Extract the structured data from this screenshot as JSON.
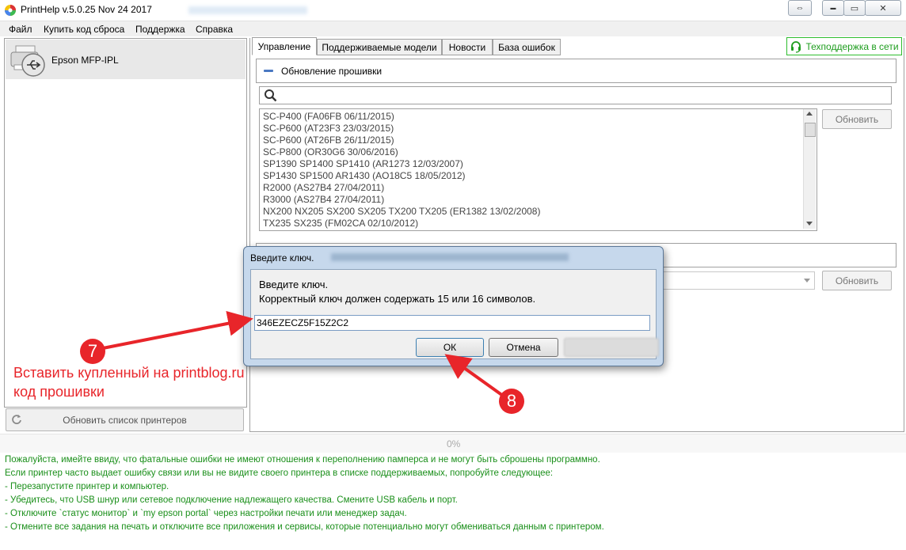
{
  "window": {
    "title": "PrintHelp v.5.0.25 Nov 24 2017",
    "close_glyph": "✕",
    "maximize_glyph": "▭",
    "minimize_glyph": "▬",
    "restore_glyph": "⇔"
  },
  "menu": {
    "items": [
      "Файл",
      "Купить код сброса",
      "Поддержка",
      "Справка"
    ]
  },
  "printers": {
    "items": [
      {
        "label": "Epson MFP-IPL",
        "icon": "usb-printer-icon"
      }
    ],
    "refresh_label": "Обновить список принтеров"
  },
  "tabs": {
    "items": [
      "Управление",
      "Поддерживаемые модели",
      "Новости",
      "База ошибок"
    ],
    "active": 0
  },
  "support_label": "Техподдержка в сети",
  "firmware": {
    "section_title": "Обновление прошивки",
    "list": [
      "SC-P400 (FA06FB 06/11/2015)",
      "SC-P600 (AT23F3 23/03/2015)",
      "SC-P600 (AT26FB 26/11/2015)",
      "SC-P800 (OR30G6 30/06/2016)",
      "SP1390 SP1400 SP1410 (AR1273 12/03/2007)",
      "SP1430 SP1500 AR1430 (AO18C5 18/05/2012)",
      "R2000 (AS27B4 27/04/2011)",
      "R3000 (AS27B4 27/04/2011)",
      "NX200 NX205 SX200 SX205 TX200 TX205 (ER1382 13/02/2008)",
      "TX235 SX235 (FM02CA 02/10/2012)"
    ],
    "update_label": "Обновить"
  },
  "section2": {
    "update_label": "Обновить"
  },
  "progress": {
    "text": "0%"
  },
  "log": [
    "Пожалуйста, имейте ввиду, что фатальные ошибки не имеют отношения к переполнению памперса и не могут быть сброшены программно.",
    "Если принтер часто выдает ошибку связи или вы не видите своего принтера в списке поддерживаемых, попробуйте следующее:",
    "- Перезапустите принтер и компьютер.",
    "- Убедитесь, что USB шнур или сетевое подключение надлежащего качества. Смените USB кабель и порт.",
    "- Отключите `статус монитор` и `my epson portal` через настройки печати или менеджер задач.",
    "- Отмените все задания на печать и отключите все приложения и сервисы, которые потенциально могут обмениваться данным с принтером."
  ],
  "dialog": {
    "title": "Введите ключ.",
    "prompt_line1": "Введите ключ.",
    "prompt_line2": "Корректный ключ должен содержать 15 или 16 символов.",
    "key_value": "346EZECZ5F15Z2C2",
    "ok_label": "ОК",
    "cancel_label": "Отмена"
  },
  "annotations": {
    "badge1": "7",
    "badge2": "8",
    "text_line1": "Вставить купленный на printblog.ru",
    "text_line2": "код прошивки",
    "color": "#e8252a"
  },
  "colors": {
    "log_text": "#1a8f1a",
    "support_green": "#2ebd2e",
    "annotation_red": "#e8252a"
  }
}
